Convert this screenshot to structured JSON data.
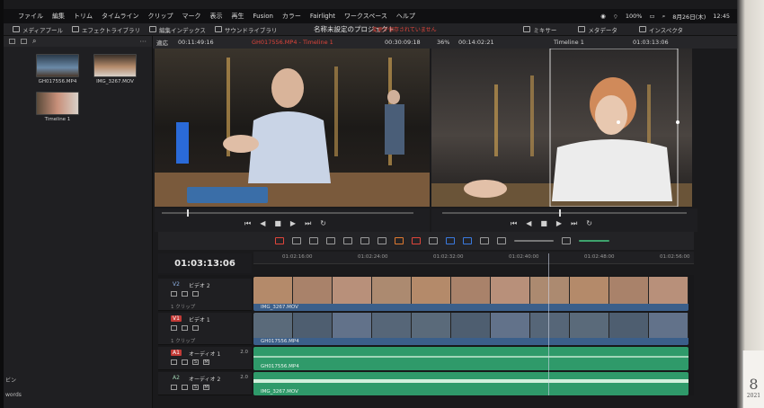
{
  "menubar": {
    "items": [
      "ファイル",
      "編集",
      "トリム",
      "タイムライン",
      "クリップ",
      "マーク",
      "表示",
      "再生",
      "Fusion",
      "カラー",
      "Fairlight",
      "ワークスペース",
      "ヘルプ"
    ],
    "battery": "100%",
    "date": "8月26日(木)",
    "time": "12:45"
  },
  "toolbar": {
    "media_pool": "メディアプール",
    "effects": "エフェクトライブラリ",
    "edit_index": "編集インデックス",
    "sound_library": "サウンドライブラリ",
    "project_name": "名称未設定のプロジェクト",
    "unsaved": "変更が保存されていません",
    "mixer": "ミキサー",
    "metadata": "メタデータ",
    "inspector": "インスペクタ"
  },
  "media_pool": {
    "clips": [
      {
        "label": "GH017556.MP4",
        "color": "#6b8aa8"
      },
      {
        "label": "IMG_3267.MOV",
        "color": "#b48a6a"
      },
      {
        "label": "Timeline 1",
        "color": "#c8907a"
      }
    ],
    "bottom_1": "ビン",
    "bottom_2": "words"
  },
  "viewer_header": {
    "source_fit": "適応",
    "source_timecode": "00:11:49:16",
    "source_clip": "GH017556.MP4 - Timeline 1",
    "duration": "00:30:09:18",
    "zoom": "36%",
    "record_timecode": "00:14:02:21",
    "timeline_name": "Timeline 1",
    "timeline_timecode": "01:03:13:06"
  },
  "timeline": {
    "current_timecode": "01:03:13:06",
    "ruler": [
      "01:02:16:00",
      "01:02:24:00",
      "01:02:32:00",
      "01:02:40:00",
      "01:02:48:00",
      "01:02:56:00"
    ],
    "tracks": [
      {
        "id": "V2",
        "name": "ビデオ 2",
        "count": "1 クリップ",
        "clip": "IMG_3267.MOV",
        "color": "#3b5f8a"
      },
      {
        "id": "V1",
        "name": "ビデオ 1",
        "count": "1 クリップ",
        "clip": "GH017556.MP4",
        "color": "#3b5f8a"
      },
      {
        "id": "A1",
        "name": "オーディオ 1",
        "level": "2.0",
        "clip": "GH017556.MP4"
      },
      {
        "id": "A2",
        "name": "オーディオ 2",
        "level": "2.0",
        "clip": "IMG_3267.MOV"
      }
    ]
  },
  "calendar": {
    "day": "8",
    "year": "2021"
  }
}
